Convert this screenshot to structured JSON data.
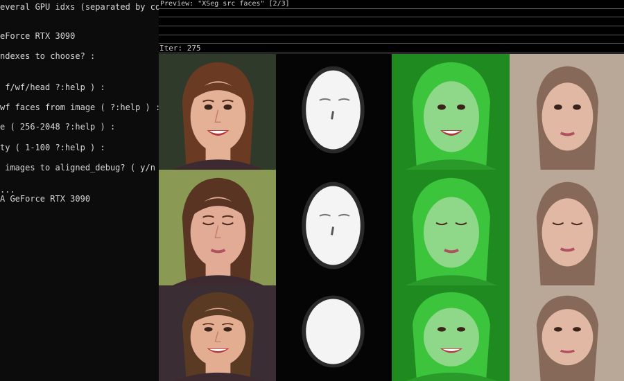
{
  "console": {
    "lines": [
      "everal GPU idxs (separated by comma",
      "",
      "eForce RTX 3090",
      "",
      "ndexes to choose? :",
      "",
      "",
      " f/wf/head ?:help ) :",
      "",
      "wf faces from image ( ?:help ) :",
      "",
      "e ( 256-2048 ?:help ) :",
      "",
      "ty ( 1-100 ?:help ) :",
      "",
      " images to aligned_debug? ( y/n ) :",
      "",
      "...",
      "A GeForce RTX 3090"
    ]
  },
  "preview": {
    "title": "Preview: \"XSeg src faces\" [2/3]",
    "iter_label": "Iter: 275",
    "columns": [
      "source-face",
      "predicted-mask",
      "masked-overlay",
      "reconstructed-face"
    ],
    "rows": [
      {
        "variant": "smiling",
        "hair": "#6a3a22",
        "skin": "#e4b096",
        "bg": "#2f3a2a"
      },
      {
        "variant": "eyes-closed",
        "hair": "#5a3423",
        "skin": "#e2ab96",
        "bg": "#8a9a55"
      },
      {
        "variant": "smiling-indoor",
        "hair": "#5b3a24",
        "skin": "#e3ad92",
        "bg": "#3a2d33"
      }
    ],
    "colors": {
      "overlay": "#3cc43c",
      "overlay_dark": "#1f8a1f",
      "reconstruction_bg": "#b9a797",
      "mask_white": "#ffffff"
    }
  }
}
